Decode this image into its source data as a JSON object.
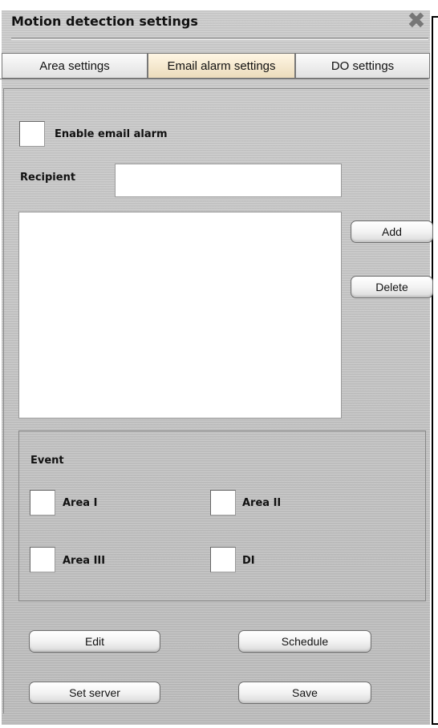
{
  "window": {
    "title": "Motion detection settings",
    "close_glyph": "✖"
  },
  "tabs": [
    {
      "label": "Area settings",
      "active": false
    },
    {
      "label": "Email alarm settings",
      "active": true
    },
    {
      "label": "DO settings",
      "active": false
    }
  ],
  "email": {
    "enable_label": "Enable email alarm",
    "recipient_label": "Recipient",
    "recipient_value": "",
    "add_label": "Add",
    "delete_label": "Delete",
    "recipients": []
  },
  "event": {
    "title": "Event",
    "items": [
      {
        "label": "Area I",
        "checked": false
      },
      {
        "label": "Area II",
        "checked": false
      },
      {
        "label": "Area III",
        "checked": false
      },
      {
        "label": "DI",
        "checked": false
      }
    ]
  },
  "footer": {
    "edit_label": "Edit",
    "schedule_label": "Schedule",
    "set_server_label": "Set server",
    "save_label": "Save"
  },
  "colors": {
    "active_tab": "#ecdcbc",
    "panel_background": "#c2c2c2"
  }
}
